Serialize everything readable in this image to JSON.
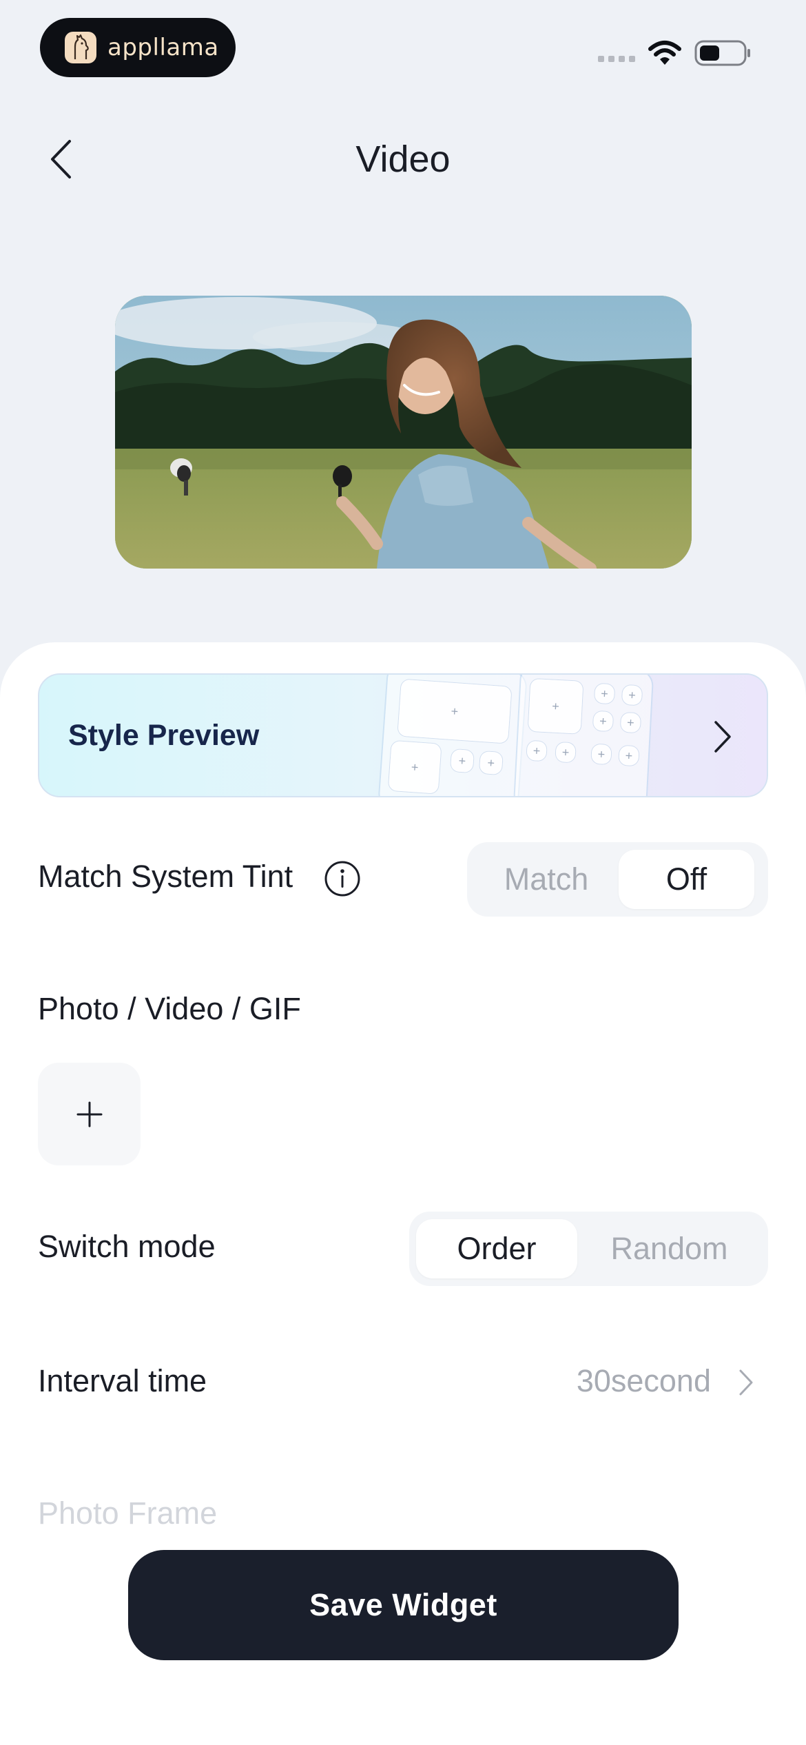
{
  "status_bar": {
    "brand_name": "appllama",
    "icons": [
      "signal-icon",
      "wifi-icon",
      "battery-icon"
    ]
  },
  "header": {
    "title": "Video",
    "back_icon": "chevron-left-icon"
  },
  "preview": {
    "image": "video-thumbnail-woman-in-field"
  },
  "style_preview": {
    "label": "Style Preview",
    "icon": "chevron-right-icon"
  },
  "match_tint": {
    "label": "Match System Tint",
    "info_icon": "info-icon",
    "options": [
      "Match",
      "Off"
    ],
    "selected": "Off"
  },
  "media": {
    "label": "Photo / Video / GIF",
    "add_icon": "plus-icon"
  },
  "switch_mode": {
    "label": "Switch mode",
    "options": [
      "Order",
      "Random"
    ],
    "selected": "Order"
  },
  "interval": {
    "label": "Interval time",
    "value": "30second"
  },
  "photo_frame": {
    "label": "Photo Frame"
  },
  "save": {
    "label": "Save Widget"
  },
  "colors": {
    "background": "#eef1f6",
    "sheet": "#ffffff",
    "primary_button": "#1a1f2c",
    "muted_text": "#a7abb3",
    "style_preview_text": "#17264b"
  }
}
